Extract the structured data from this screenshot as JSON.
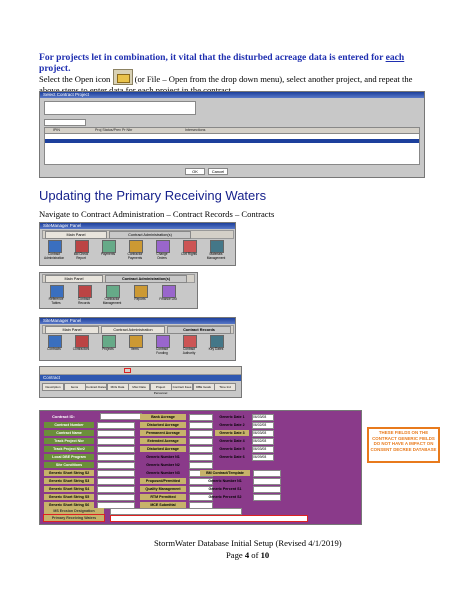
{
  "intro": {
    "text_before": "For projects let in combination, it vital that the disturbed acreage data is entered for ",
    "emph": "each",
    "text_after": " project."
  },
  "para1": {
    "before_icon": "Select the Open icon",
    "after_icon": "(or File – Open from the drop down menu), select another project, and repeat the above steps to enter data for each project in the contract."
  },
  "shot1": {
    "title": "Select Contract Project",
    "col1": "IPIN",
    "col2": "Proj Status/Prev Pr Nbr",
    "col3": "Intersections",
    "ok": "OK",
    "cancel": "Cancel"
  },
  "heading": "Updating the Primary Receiving Waters",
  "nav": "Navigate to Contract Administration – Contract Records – Contracts",
  "shot2": {
    "title": "SiteManager Panel",
    "tab1": "Main Panel",
    "tab2": "Contract Administration(s)",
    "icons": [
      "Contract Administration",
      "Bid Check Report",
      "Payments",
      "Contractor Payments",
      "Change Orders",
      "Civil Rights",
      "Materials Management"
    ]
  },
  "shot3": {
    "tab1": "Main Panel",
    "tab2": "Contract Administration(s)",
    "icons": [
      "Reference Tables",
      "Contract Records",
      "Contractor Management",
      "Reports",
      "Finance List"
    ]
  },
  "shot4": {
    "title": "SiteManager Panel",
    "tab1": "Main Panel",
    "tab2": "Contract Administration",
    "tab3": "Contract Records",
    "icons": [
      "Contracts",
      "Contractors",
      "Projects",
      "Items",
      "Contract Funding",
      "Contract Authority",
      "Key Dates"
    ]
  },
  "shot5": {
    "title": "Contract",
    "tabs": [
      "Description",
      "Items",
      "Contract Dates",
      "Mtrls Data",
      "Misc Data",
      "Project Personnel",
      "Contract Fees",
      "DBE Goals",
      "Time Ind"
    ]
  },
  "shot6": {
    "contract_id": "Contract ID:",
    "left_labels": [
      "Contract Number",
      "Contract Name",
      "Track Project Nbr",
      "Track Project Nbr2",
      "Local DBE Program",
      "Site Conditions"
    ],
    "generic_left": [
      "Generic Short String S2",
      "Generic Short String S3",
      "Generic Short String S4",
      "Generic Short String S5",
      "Generic Short String S6"
    ],
    "mid_labels": [
      "Bank Acreage",
      "Disturbed Acreage",
      "Permanent Acreage",
      "Extended Acreage",
      "Disturbed Acreage"
    ],
    "mid_lower": [
      "Generic Number N1",
      "Generic Number N2",
      "Generic Number N3",
      "Proposed/Permitted",
      "Quality Management",
      "RTM Permitted",
      "MCE Submittal"
    ],
    "dates_labels": [
      "Generic Date 1",
      "Generic Date 2",
      "Generic Date 3",
      "Generic Date 4",
      "Generic Date 5",
      "Generic Date 6"
    ],
    "dates_values": [
      "06/03/08",
      "06/02/08",
      "06/03/08",
      "06/02/08",
      "06/03/08",
      "06/09/08"
    ],
    "right_lower": [
      "BM Contract/Template",
      "Generic Number N1",
      "Generic Percent S1",
      "Generic Percent S2"
    ],
    "bottom1": "MS Erosion Designation",
    "bottom2": "Primary Receiving Waters",
    "note": "THESE FIELDS ON THE CONTRACT GENERIC FIELDS DO NOT HAVE A IMPACT ON CONSENT DECREE DATABASE"
  },
  "footer": {
    "line1": "StormWater Database Initial Setup (Revised 4/1/2019)",
    "page_prefix": "Page ",
    "page_num": "4",
    "page_mid": " of ",
    "page_total": "10"
  }
}
